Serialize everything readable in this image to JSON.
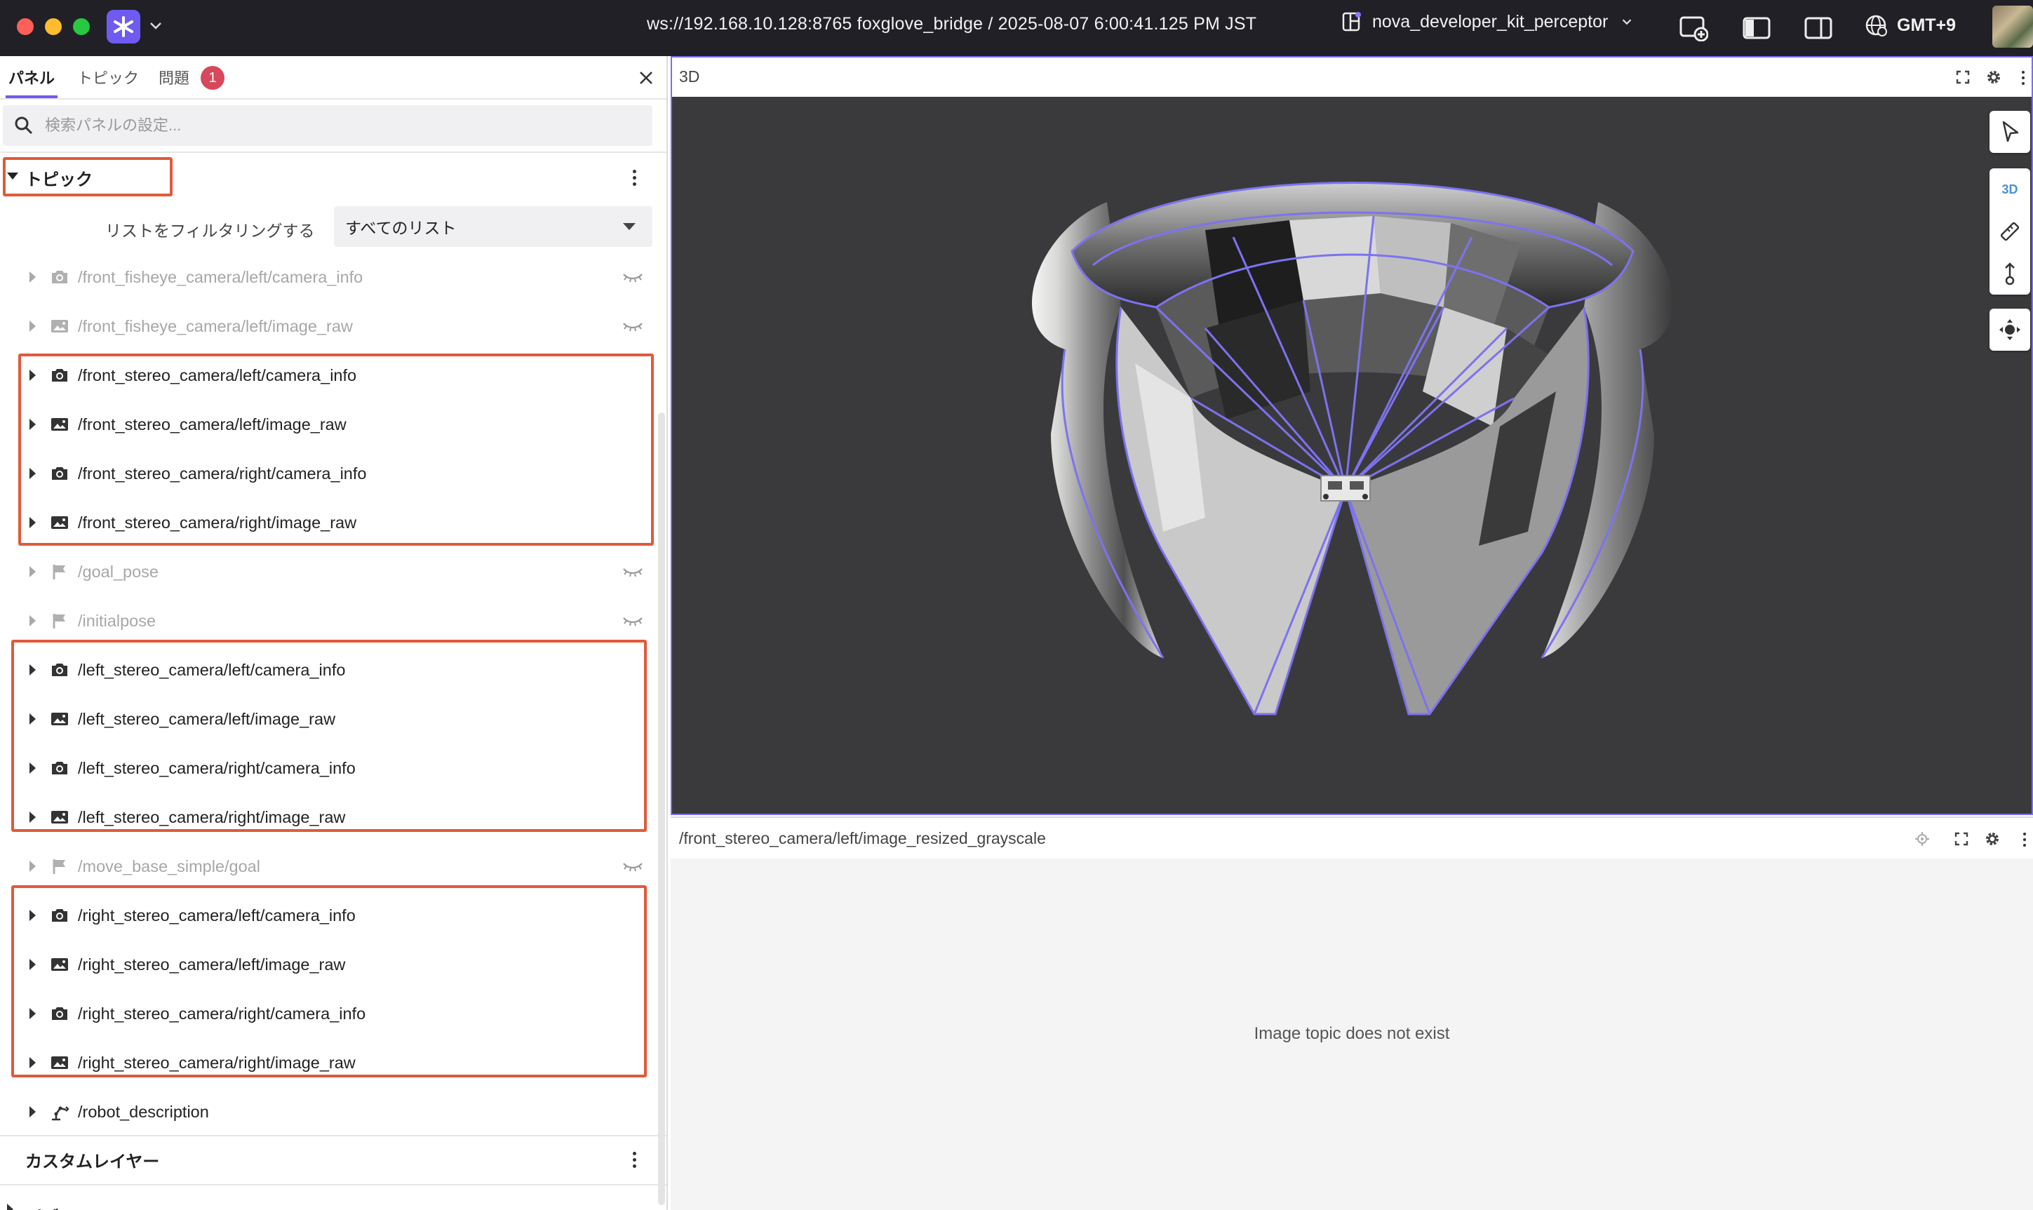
{
  "titlebar": {
    "connection": "ws://192.168.10.128:8765 foxglove_bridge / 2025-08-07 6:00:41.125 PM JST",
    "layout_name": "nova_developer_kit_perceptor",
    "timezone": "GMT+9",
    "icons": [
      "foxglove-logo-icon",
      "chevron-down-icon",
      "layout-icon",
      "add-panel-icon",
      "left-sidebar-icon",
      "right-sidebar-icon",
      "globe-icon"
    ]
  },
  "sidebar": {
    "tabs": [
      {
        "label": "パネル",
        "active": true
      },
      {
        "label": "トピック",
        "active": false
      },
      {
        "label": "問題",
        "active": false
      }
    ],
    "problem_count": "1",
    "search_placeholder": "検索パネルの設定...",
    "topics_section": {
      "title": "トピック",
      "filter_label": "リストをフィルタリングする",
      "filter_value": "すべてのリスト",
      "rows": [
        {
          "name": "/front_fisheye_camera/left/camera_info",
          "icon": "camera-icon",
          "visible": false
        },
        {
          "name": "/front_fisheye_camera/left/image_raw",
          "icon": "image-icon",
          "visible": false
        },
        {
          "name": "/front_stereo_camera/left/camera_info",
          "icon": "camera-icon",
          "visible": true
        },
        {
          "name": "/front_stereo_camera/left/image_raw",
          "icon": "image-icon",
          "visible": true
        },
        {
          "name": "/front_stereo_camera/right/camera_info",
          "icon": "camera-icon",
          "visible": true
        },
        {
          "name": "/front_stereo_camera/right/image_raw",
          "icon": "image-icon",
          "visible": true
        },
        {
          "name": "/goal_pose",
          "icon": "flag-icon",
          "visible": false
        },
        {
          "name": "/initialpose",
          "icon": "flag-icon",
          "visible": false
        },
        {
          "name": "/left_stereo_camera/left/camera_info",
          "icon": "camera-icon",
          "visible": true
        },
        {
          "name": "/left_stereo_camera/left/image_raw",
          "icon": "image-icon",
          "visible": true
        },
        {
          "name": "/left_stereo_camera/right/camera_info",
          "icon": "camera-icon",
          "visible": true
        },
        {
          "name": "/left_stereo_camera/right/image_raw",
          "icon": "image-icon",
          "visible": true
        },
        {
          "name": "/move_base_simple/goal",
          "icon": "flag-icon",
          "visible": false
        },
        {
          "name": "/right_stereo_camera/left/camera_info",
          "icon": "camera-icon",
          "visible": true
        },
        {
          "name": "/right_stereo_camera/left/image_raw",
          "icon": "image-icon",
          "visible": true
        },
        {
          "name": "/right_stereo_camera/right/camera_info",
          "icon": "camera-icon",
          "visible": true
        },
        {
          "name": "/right_stereo_camera/right/image_raw",
          "icon": "image-icon",
          "visible": true
        },
        {
          "name": "/robot_description",
          "icon": "robot-arm-icon",
          "visible": true
        }
      ]
    },
    "custom_layers_title": "カスタムレイヤー",
    "publish_title": "パブリッシュ"
  },
  "panels": {
    "three_d": {
      "title": "3D",
      "toolbar_3d_label": "3D"
    },
    "image": {
      "title": "/front_stereo_camera/left/image_resized_grayscale",
      "empty_message": "Image topic does not exist"
    }
  },
  "colors": {
    "accent": "#6f5bf0",
    "highlight_box": "#e05a3a",
    "frustum": "#7d72f0",
    "badge": "#d9475a",
    "viewport_bg": "#3a3a3c"
  }
}
